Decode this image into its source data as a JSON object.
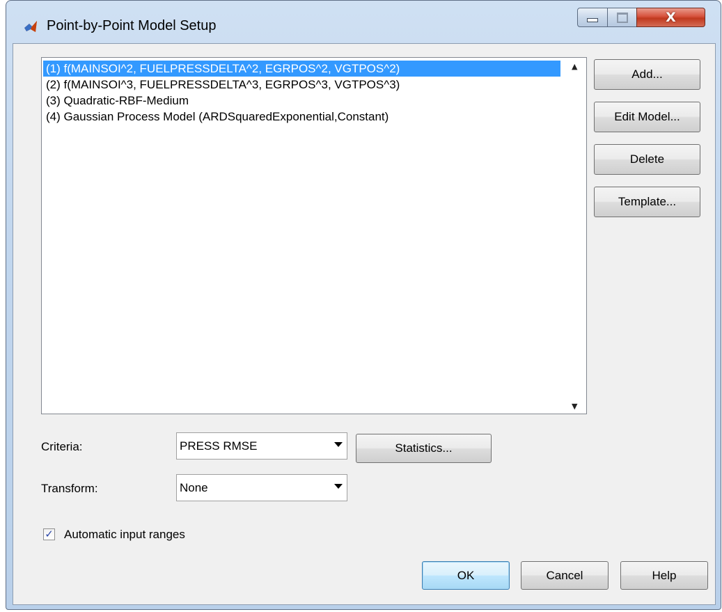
{
  "window": {
    "title": "Point-by-Point Model Setup",
    "icon": "matlab-logo-icon",
    "close_glyph": "X"
  },
  "models": {
    "items": [
      {
        "label": "(1)  f(MAINSOI^2, FUELPRESSDELTA^2, EGRPOS^2, VGTPOS^2)",
        "selected": true
      },
      {
        "label": "(2)  f(MAINSOI^3, FUELPRESSDELTA^3, EGRPOS^3, VGTPOS^3)",
        "selected": false
      },
      {
        "label": "(3)  Quadratic-RBF-Medium",
        "selected": false
      },
      {
        "label": "(4)  Gaussian Process Model (ARDSquaredExponential,Constant)",
        "selected": false
      }
    ]
  },
  "side_buttons": {
    "add": "Add...",
    "edit": "Edit Model...",
    "delete": "Delete",
    "template": "Template..."
  },
  "criteria": {
    "label": "Criteria:",
    "value": "PRESS RMSE",
    "statistics_button": "Statistics..."
  },
  "transform": {
    "label": "Transform:",
    "value": "None"
  },
  "auto_ranges": {
    "label": "Automatic input ranges",
    "checked": true
  },
  "footer": {
    "ok": "OK",
    "cancel": "Cancel",
    "help": "Help"
  },
  "colors": {
    "selection": "#3399ff",
    "client_bg": "#f0f0f0",
    "close_button": "#c0391f"
  }
}
